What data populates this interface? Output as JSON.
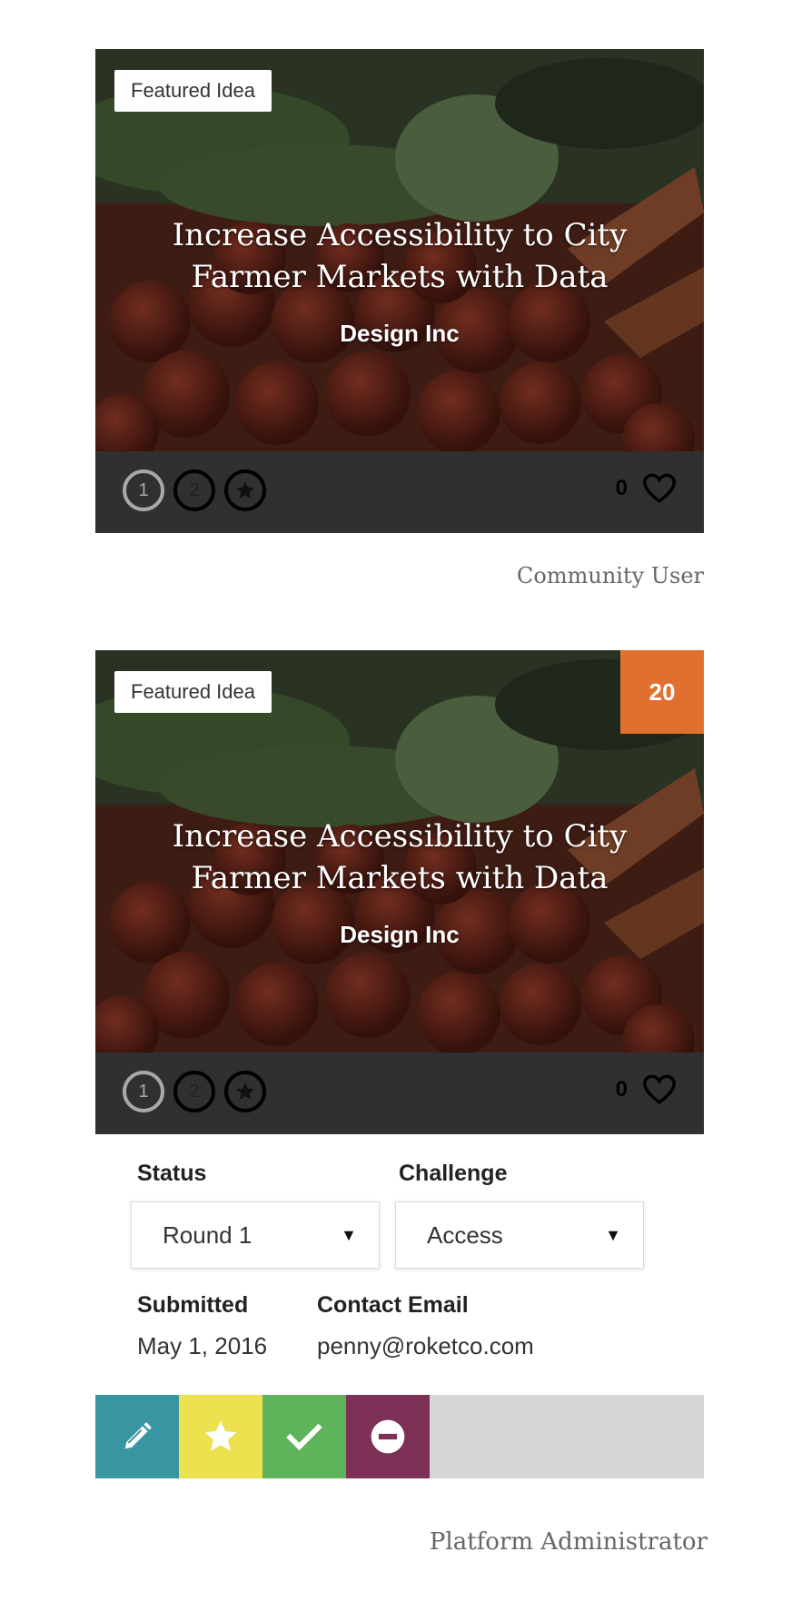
{
  "colors": {
    "score_badge": "#e07030",
    "footer_bar": "#303030",
    "edit_action": "#3a95a3",
    "feature_action": "#ece250",
    "approve_action": "#5fb35b",
    "remove_action": "#7e3157",
    "actions_bar": "#d6d6d6"
  },
  "cards": [
    {
      "featured_label": "Featured Idea",
      "title": "Increase Accessibility to City Farmer Markets with Data",
      "company": "Design Inc",
      "badges": [
        "1",
        "2",
        "star-icon"
      ],
      "likes": "0"
    },
    {
      "featured_label": "Featured Idea",
      "score": "20",
      "title": "Increase Accessibility to City Farmer Markets with Data",
      "company": "Design Inc",
      "badges": [
        "1",
        "2",
        "star-icon"
      ],
      "likes": "0"
    }
  ],
  "roles": {
    "community": "Community User",
    "admin": "Platform Administrator"
  },
  "admin": {
    "status_label": "Status",
    "status_value": "Round 1",
    "challenge_label": "Challenge",
    "challenge_value": "Access",
    "submitted_label": "Submitted",
    "submitted_value": "May 1, 2016",
    "email_label": "Contact Email",
    "email_value": "penny@roketco.com",
    "actions": [
      "pencil-icon",
      "star-icon",
      "check-icon",
      "minus-circle-icon"
    ]
  }
}
